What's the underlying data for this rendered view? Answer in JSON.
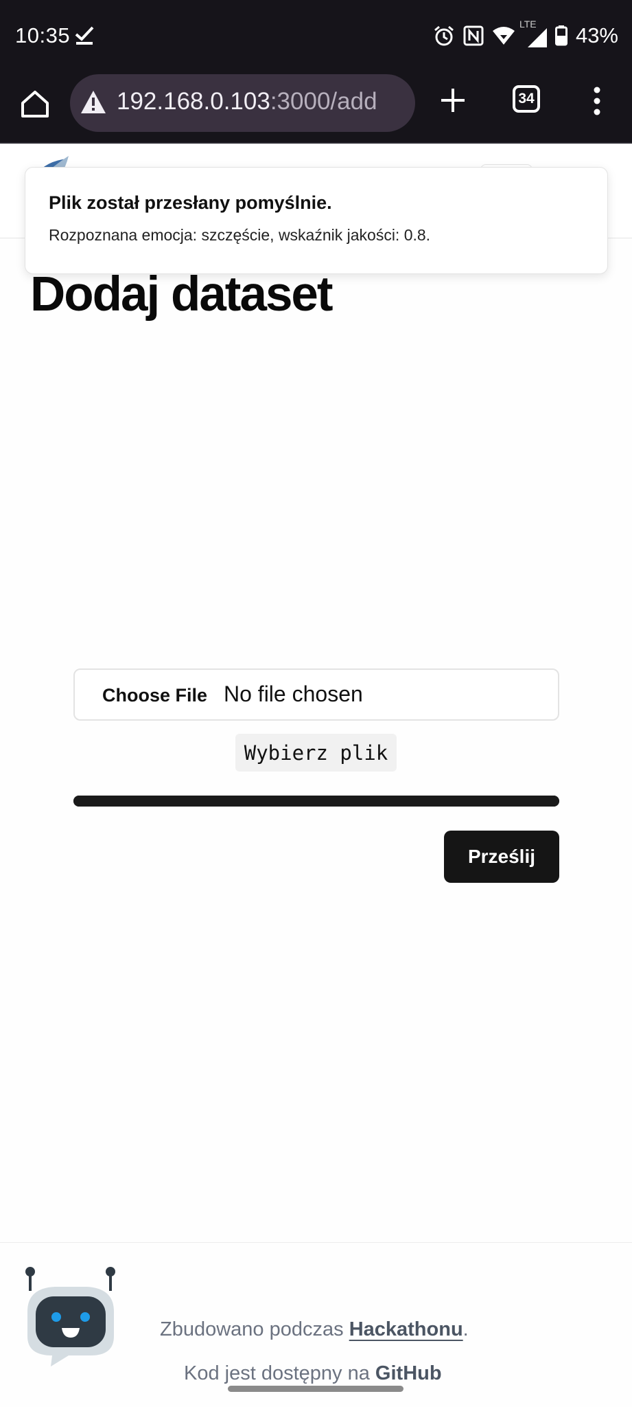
{
  "status_bar": {
    "time": "10:35",
    "battery_percent": "43%",
    "network": "LTE",
    "icons": [
      "check-icon",
      "alarm-icon",
      "nfc-icon",
      "wifi-icon",
      "signal-icon",
      "battery-icon"
    ]
  },
  "browser": {
    "url_host": "192.168.0.103",
    "url_rest": ":3000/add",
    "tab_count": "34",
    "icons": [
      "home-icon",
      "warning-icon",
      "plus-icon",
      "tabs-icon",
      "more-vert-icon"
    ]
  },
  "toast": {
    "title": "Plik został przesłany pomyślnie.",
    "description": "Rozpoznana emocja: szczęście, wskaźnik jakości: 0.8."
  },
  "main": {
    "title": "Dodaj dataset",
    "file_input": {
      "button_label": "Choose File",
      "status": "No file chosen"
    },
    "file_label": "Wybierz plik",
    "progress": 1.0,
    "submit_label": "Prześlij"
  },
  "footer": {
    "built_text": "Zbudowano podczas ",
    "built_link": "Hackathonu",
    "built_end": ".",
    "code_text": "Kod jest dostępny na ",
    "code_link": "GitHub"
  },
  "colors": {
    "chrome_dark": "#16141a",
    "url_pill": "#3a3140",
    "primary_button": "#151515",
    "robot_accent": "#1e9be8"
  }
}
